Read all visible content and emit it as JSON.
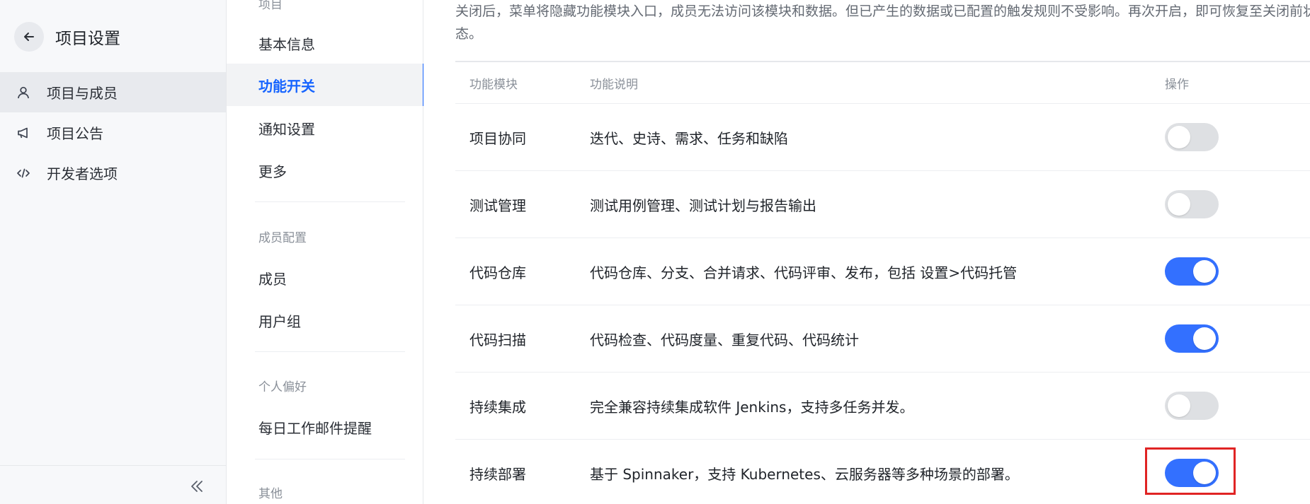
{
  "sidebar": {
    "title": "项目设置",
    "back_icon": "arrow-left-icon",
    "items": [
      {
        "label": "项目与成员",
        "icon": "user-icon",
        "active": true
      },
      {
        "label": "项目公告",
        "icon": "megaphone-icon",
        "active": false
      },
      {
        "label": "开发者选项",
        "icon": "code-icon",
        "active": false
      }
    ],
    "collapse_icon": "double-chevron-left-icon"
  },
  "menu": {
    "partial_top_label": "项目",
    "items": {
      "basic_info": "基本信息",
      "feature_switch": "功能开关",
      "notification": "通知设置",
      "more": "更多",
      "members": "成员",
      "user_groups": "用户组",
      "daily_email": "每日工作邮件提醒"
    },
    "groups": {
      "member_config": "成员配置",
      "personal_pref": "个人偏好",
      "other": "其他"
    }
  },
  "main": {
    "description": "关闭后，菜单将隐藏功能模块入口，成员无法访问该模块和数据。但已产生的数据或已配置的触发规则不受影响。再次开启，即可恢复至关闭前状态。",
    "table": {
      "headers": {
        "module": "功能模块",
        "desc": "功能说明",
        "action": "操作"
      },
      "rows": [
        {
          "module": "项目协同",
          "desc": "迭代、史诗、需求、任务和缺陷",
          "enabled": false
        },
        {
          "module": "测试管理",
          "desc": "测试用例管理、测试计划与报告输出",
          "enabled": false
        },
        {
          "module": "代码仓库",
          "desc": "代码仓库、分支、合并请求、代码评审、发布，包括 设置>代码托管",
          "enabled": true
        },
        {
          "module": "代码扫描",
          "desc": "代码检查、代码度量、重复代码、代码统计",
          "enabled": true
        },
        {
          "module": "持续集成",
          "desc": "完全兼容持续集成软件 Jenkins，支持多任务并发。",
          "enabled": false
        },
        {
          "module": "持续部署",
          "desc": "基于 Spinnaker，支持 Kubernetes、云服务器等多种场景的部署。",
          "enabled": true
        }
      ]
    }
  },
  "colors": {
    "accent": "#3370ff",
    "active_text": "#1664ff",
    "highlight": "#e02424",
    "toggle_off": "#dee0e3"
  }
}
